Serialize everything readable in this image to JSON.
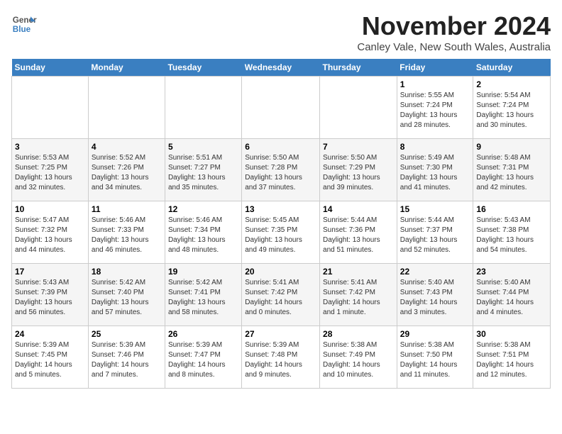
{
  "header": {
    "logo_general": "General",
    "logo_blue": "Blue",
    "month_title": "November 2024",
    "location": "Canley Vale, New South Wales, Australia"
  },
  "weekdays": [
    "Sunday",
    "Monday",
    "Tuesday",
    "Wednesday",
    "Thursday",
    "Friday",
    "Saturday"
  ],
  "weeks": [
    [
      {
        "day": "",
        "info": ""
      },
      {
        "day": "",
        "info": ""
      },
      {
        "day": "",
        "info": ""
      },
      {
        "day": "",
        "info": ""
      },
      {
        "day": "",
        "info": ""
      },
      {
        "day": "1",
        "info": "Sunrise: 5:55 AM\nSunset: 7:24 PM\nDaylight: 13 hours\nand 28 minutes."
      },
      {
        "day": "2",
        "info": "Sunrise: 5:54 AM\nSunset: 7:24 PM\nDaylight: 13 hours\nand 30 minutes."
      }
    ],
    [
      {
        "day": "3",
        "info": "Sunrise: 5:53 AM\nSunset: 7:25 PM\nDaylight: 13 hours\nand 32 minutes."
      },
      {
        "day": "4",
        "info": "Sunrise: 5:52 AM\nSunset: 7:26 PM\nDaylight: 13 hours\nand 34 minutes."
      },
      {
        "day": "5",
        "info": "Sunrise: 5:51 AM\nSunset: 7:27 PM\nDaylight: 13 hours\nand 35 minutes."
      },
      {
        "day": "6",
        "info": "Sunrise: 5:50 AM\nSunset: 7:28 PM\nDaylight: 13 hours\nand 37 minutes."
      },
      {
        "day": "7",
        "info": "Sunrise: 5:50 AM\nSunset: 7:29 PM\nDaylight: 13 hours\nand 39 minutes."
      },
      {
        "day": "8",
        "info": "Sunrise: 5:49 AM\nSunset: 7:30 PM\nDaylight: 13 hours\nand 41 minutes."
      },
      {
        "day": "9",
        "info": "Sunrise: 5:48 AM\nSunset: 7:31 PM\nDaylight: 13 hours\nand 42 minutes."
      }
    ],
    [
      {
        "day": "10",
        "info": "Sunrise: 5:47 AM\nSunset: 7:32 PM\nDaylight: 13 hours\nand 44 minutes."
      },
      {
        "day": "11",
        "info": "Sunrise: 5:46 AM\nSunset: 7:33 PM\nDaylight: 13 hours\nand 46 minutes."
      },
      {
        "day": "12",
        "info": "Sunrise: 5:46 AM\nSunset: 7:34 PM\nDaylight: 13 hours\nand 48 minutes."
      },
      {
        "day": "13",
        "info": "Sunrise: 5:45 AM\nSunset: 7:35 PM\nDaylight: 13 hours\nand 49 minutes."
      },
      {
        "day": "14",
        "info": "Sunrise: 5:44 AM\nSunset: 7:36 PM\nDaylight: 13 hours\nand 51 minutes."
      },
      {
        "day": "15",
        "info": "Sunrise: 5:44 AM\nSunset: 7:37 PM\nDaylight: 13 hours\nand 52 minutes."
      },
      {
        "day": "16",
        "info": "Sunrise: 5:43 AM\nSunset: 7:38 PM\nDaylight: 13 hours\nand 54 minutes."
      }
    ],
    [
      {
        "day": "17",
        "info": "Sunrise: 5:43 AM\nSunset: 7:39 PM\nDaylight: 13 hours\nand 56 minutes."
      },
      {
        "day": "18",
        "info": "Sunrise: 5:42 AM\nSunset: 7:40 PM\nDaylight: 13 hours\nand 57 minutes."
      },
      {
        "day": "19",
        "info": "Sunrise: 5:42 AM\nSunset: 7:41 PM\nDaylight: 13 hours\nand 58 minutes."
      },
      {
        "day": "20",
        "info": "Sunrise: 5:41 AM\nSunset: 7:42 PM\nDaylight: 14 hours\nand 0 minutes."
      },
      {
        "day": "21",
        "info": "Sunrise: 5:41 AM\nSunset: 7:42 PM\nDaylight: 14 hours\nand 1 minute."
      },
      {
        "day": "22",
        "info": "Sunrise: 5:40 AM\nSunset: 7:43 PM\nDaylight: 14 hours\nand 3 minutes."
      },
      {
        "day": "23",
        "info": "Sunrise: 5:40 AM\nSunset: 7:44 PM\nDaylight: 14 hours\nand 4 minutes."
      }
    ],
    [
      {
        "day": "24",
        "info": "Sunrise: 5:39 AM\nSunset: 7:45 PM\nDaylight: 14 hours\nand 5 minutes."
      },
      {
        "day": "25",
        "info": "Sunrise: 5:39 AM\nSunset: 7:46 PM\nDaylight: 14 hours\nand 7 minutes."
      },
      {
        "day": "26",
        "info": "Sunrise: 5:39 AM\nSunset: 7:47 PM\nDaylight: 14 hours\nand 8 minutes."
      },
      {
        "day": "27",
        "info": "Sunrise: 5:39 AM\nSunset: 7:48 PM\nDaylight: 14 hours\nand 9 minutes."
      },
      {
        "day": "28",
        "info": "Sunrise: 5:38 AM\nSunset: 7:49 PM\nDaylight: 14 hours\nand 10 minutes."
      },
      {
        "day": "29",
        "info": "Sunrise: 5:38 AM\nSunset: 7:50 PM\nDaylight: 14 hours\nand 11 minutes."
      },
      {
        "day": "30",
        "info": "Sunrise: 5:38 AM\nSunset: 7:51 PM\nDaylight: 14 hours\nand 12 minutes."
      }
    ]
  ]
}
